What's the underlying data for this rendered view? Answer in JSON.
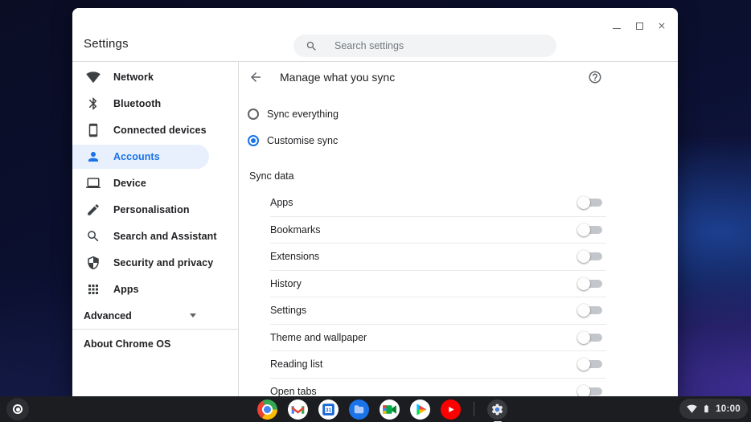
{
  "window": {
    "title": "Settings",
    "search_placeholder": "Search settings"
  },
  "sidebar": {
    "items": [
      {
        "label": "Network",
        "icon": "wifi",
        "selected": false
      },
      {
        "label": "Bluetooth",
        "icon": "bluetooth",
        "selected": false
      },
      {
        "label": "Connected devices",
        "icon": "smartphone",
        "selected": false
      },
      {
        "label": "Accounts",
        "icon": "person",
        "selected": true
      },
      {
        "label": "Device",
        "icon": "laptop",
        "selected": false
      },
      {
        "label": "Personalisation",
        "icon": "pen",
        "selected": false
      },
      {
        "label": "Search and Assistant",
        "icon": "search",
        "selected": false
      },
      {
        "label": "Security and privacy",
        "icon": "shield",
        "selected": false
      },
      {
        "label": "Apps",
        "icon": "apps",
        "selected": false
      }
    ],
    "advanced_label": "Advanced",
    "about_label": "About Chrome OS"
  },
  "content": {
    "title": "Manage what you sync",
    "radios": [
      {
        "label": "Sync everything",
        "selected": false
      },
      {
        "label": "Customise sync",
        "selected": true
      }
    ],
    "section_title": "Sync data",
    "toggles": [
      {
        "label": "Apps",
        "on": false
      },
      {
        "label": "Bookmarks",
        "on": false
      },
      {
        "label": "Extensions",
        "on": false
      },
      {
        "label": "History",
        "on": false
      },
      {
        "label": "Settings",
        "on": false
      },
      {
        "label": "Theme and wallpaper",
        "on": false
      },
      {
        "label": "Reading list",
        "on": false
      },
      {
        "label": "Open tabs",
        "on": false
      }
    ]
  },
  "shelf": {
    "apps": [
      {
        "name": "chrome",
        "active": false
      },
      {
        "name": "gmail",
        "active": false
      },
      {
        "name": "calendar",
        "active": false
      },
      {
        "name": "files",
        "active": false
      },
      {
        "name": "meet",
        "active": false
      },
      {
        "name": "play",
        "active": false
      },
      {
        "name": "youtube",
        "active": false
      },
      {
        "name": "settings",
        "active": true
      }
    ],
    "calendar_day": "31",
    "status": {
      "time": "10:00"
    }
  },
  "colors": {
    "accent": "#1a73e8",
    "selected_bg": "#e8f0fe"
  }
}
